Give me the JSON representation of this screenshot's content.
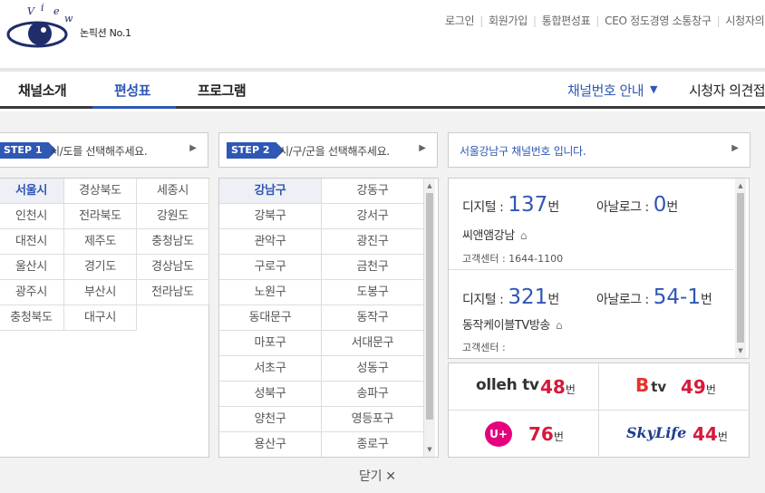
{
  "logo": {
    "letters": [
      "V",
      "i",
      "e",
      "w"
    ],
    "tagline": "논픽션 No.1",
    "brand_color": "#1f2d6b"
  },
  "top_links": [
    "로그인",
    "회원가입",
    "통합편성표",
    "CEO 정도경영 소통창구",
    "시청자의"
  ],
  "nav": {
    "items": [
      "채널소개",
      "편성표",
      "프로그램"
    ],
    "active": "편성표",
    "channel_guide": "채널번호 안내",
    "viewer": "시청자 의견접"
  },
  "step1": {
    "badge": "STEP 1",
    "text": "시/도를 선택해주세요."
  },
  "step2": {
    "badge": "STEP 2",
    "text": "시/구/군을 선택해주세요."
  },
  "step3": {
    "text": "서울강남구 채널번호 입니다."
  },
  "regions": [
    "서울시",
    "경상북도",
    "세종시",
    "인천시",
    "전라북도",
    "강원도",
    "대전시",
    "제주도",
    "충청남도",
    "울산시",
    "경기도",
    "경상남도",
    "광주시",
    "부산시",
    "전라남도",
    "충청북도",
    "대구시"
  ],
  "selected_region": "서울시",
  "districts": [
    "강남구",
    "강동구",
    "강북구",
    "강서구",
    "관악구",
    "광진구",
    "구로구",
    "금천구",
    "노원구",
    "도봉구",
    "동대문구",
    "동작구",
    "마포구",
    "서대문구",
    "서초구",
    "성동구",
    "성북구",
    "송파구",
    "양천구",
    "영등포구",
    "용산구",
    "종로구"
  ],
  "selected_district": "강남구",
  "channels": [
    {
      "digital_label": "디지털 :",
      "digital_num": "137",
      "analog_label": "아날로그 :",
      "analog_num": "0",
      "unit": "번",
      "provider": "씨앤앰강남",
      "cs": "고객센터 : 1644-1100"
    },
    {
      "digital_label": "디지털 :",
      "digital_num": "321",
      "analog_label": "아날로그 :",
      "analog_num": "54-1",
      "unit": "번",
      "provider": "동작케이블TV방송",
      "cs": "고객센터 :"
    }
  ],
  "iptv": [
    {
      "brand": "olleh tv",
      "num": "48",
      "unit": "번",
      "icon": "olleh-tv-logo-icon"
    },
    {
      "brand": "tv",
      "num": "49",
      "unit": "번",
      "icon": "btv-logo-icon"
    },
    {
      "brand": "U+",
      "num": "76",
      "unit": "번",
      "icon": "uplus-logo-icon"
    },
    {
      "brand": "SkyLife",
      "num": "44",
      "unit": "번",
      "icon": "skylife-logo-icon"
    }
  ],
  "close_label": "닫기 ✕",
  "colors": {
    "accent": "#2f57b5",
    "iptv_number": "#d61a3c",
    "btv_red": "#e6332a",
    "uplus_magenta": "#e6007e",
    "skylife_blue": "#1d3d8f"
  }
}
